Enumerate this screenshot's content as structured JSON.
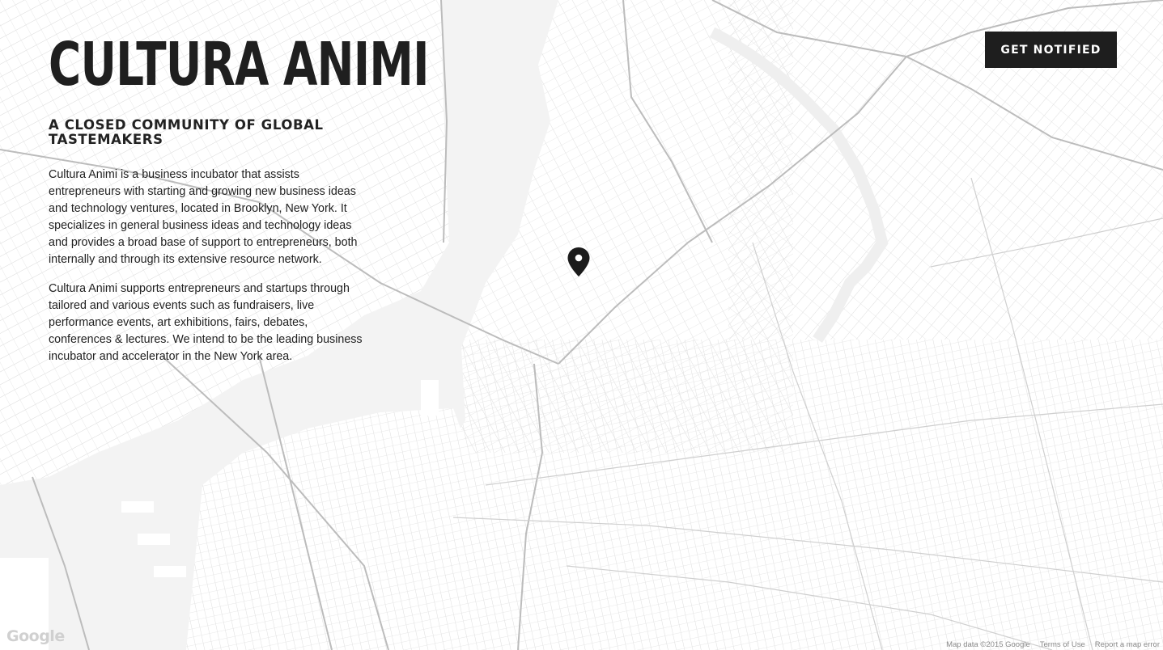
{
  "site": {
    "title": "CULTURA ANIMI",
    "tagline": "A CLOSED COMMUNITY OF GLOBAL TASTEMAKERS",
    "paragraphs": [
      "Cultura Animi is a business incubator that assists entrepreneurs with starting and growing new business ideas and technology ventures, located in Brooklyn, New York. It specializes in general business ideas and technology ideas and provides a broad base of support to entrepreneurs, both internally and through its extensive resource network.",
      "Cultura Animi supports entrepreneurs and startups through tailored and various events such as fundraisers, live performance events, art exhibitions, fairs, debates, conferences & lectures. We intend to be the leading business incubator and accelerator in the New York area."
    ]
  },
  "header": {
    "cta_label": "GET NOTIFIED"
  },
  "map": {
    "logo": "Google",
    "attribution": {
      "map_data": "Map data ©2015 Google",
      "terms": "Terms of Use",
      "report": "Report a map error"
    },
    "marker_icon": "location-pin-icon",
    "colors": {
      "water": "#f3f3f3",
      "land": "#ffffff",
      "minor_road": "#d6d6d6",
      "major_road": "#bdbdbd",
      "text": "#222222",
      "button": "#1e1e1e"
    }
  }
}
